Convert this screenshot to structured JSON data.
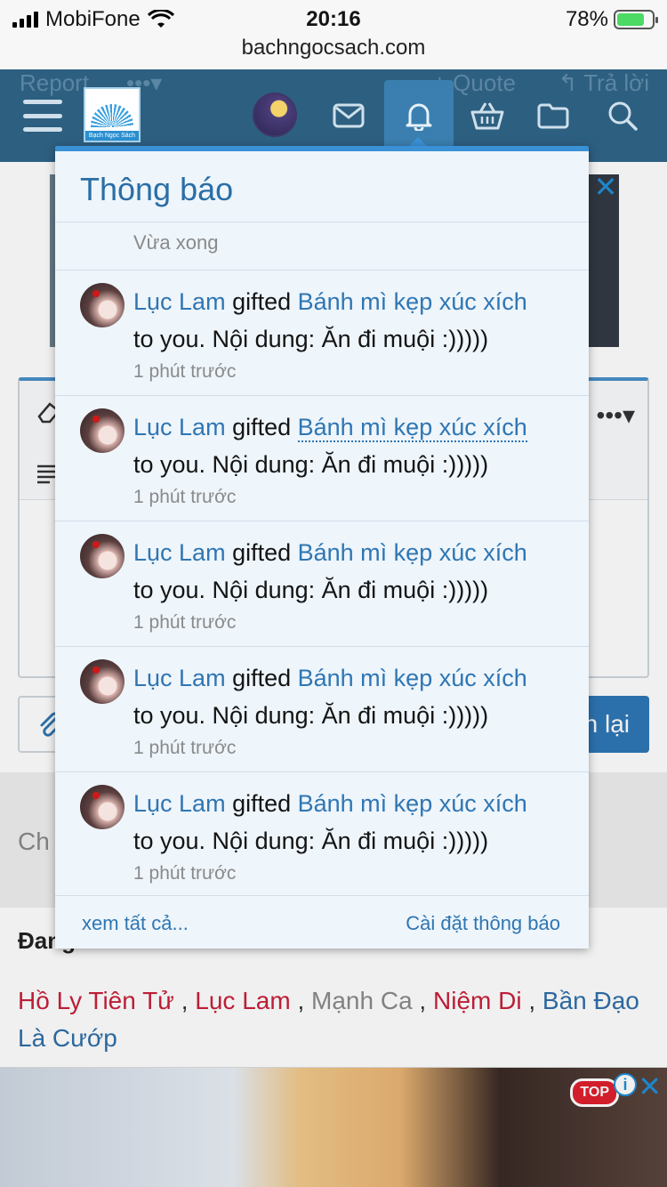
{
  "status_bar": {
    "carrier": "MobiFone",
    "time": "20:16",
    "battery": "78%",
    "battery_level": 0.78
  },
  "browser": {
    "url": "bachngocsach.com"
  },
  "header": {
    "faded_links": {
      "report": "Report",
      "more": "•••▾",
      "quote": "+ Quote",
      "reply": "↰ Trả lời"
    },
    "logo_text": "Bạch Ngọc Sách"
  },
  "notifications": {
    "title": "Thông báo",
    "just_now": "Vừa xong",
    "items": [
      {
        "user": "Lục Lam",
        "verb": " gifted ",
        "gift": "Bánh mì kẹp xúc xích",
        "message": "to you. Nội dung: Ăn đi muội :)))))",
        "time": "1 phút trước"
      },
      {
        "user": "Lục Lam",
        "verb": " gifted ",
        "gift": "Bánh mì kẹp xúc xích",
        "message": "to you. Nội dung: Ăn đi muội :)))))",
        "time": "1 phút trước"
      },
      {
        "user": "Lục Lam",
        "verb": " gifted ",
        "gift": "Bánh mì kẹp xúc xích",
        "message": "to you. Nội dung: Ăn đi muội :)))))",
        "time": "1 phút trước"
      },
      {
        "user": "Lục Lam",
        "verb": " gifted ",
        "gift": "Bánh mì kẹp xúc xích",
        "message": "to you. Nội dung: Ăn đi muội :)))))",
        "time": "1 phút trước"
      },
      {
        "user": "Lục Lam",
        "verb": " gifted ",
        "gift": "Bánh mì kẹp xúc xích",
        "message": "to you. Nội dung: Ăn đi muội :)))))",
        "time": "1 phút trước"
      }
    ],
    "see_all": "xem tất cả...",
    "settings": "Cài đặt thông báo"
  },
  "page": {
    "reply_button": "n lại",
    "grey_text": "Ch",
    "viewers_title": "Đang",
    "viewers": [
      {
        "name": "Hồ Ly Tiên Tử",
        "color": "#c8203a"
      },
      {
        "name": "Lục Lam",
        "color": "#c8203a"
      },
      {
        "name": "Mạnh Ca",
        "color": "#8a8a8a"
      },
      {
        "name": "Niệm Di",
        "color": "#c8203a"
      },
      {
        "name": "Bần Đạo Là Cướp",
        "color": "#2f6fa8"
      }
    ],
    "ad_badge": "TOP"
  },
  "icons": [
    "menu-icon",
    "mail-icon",
    "bell-icon",
    "basket-icon",
    "folder-icon",
    "search-icon",
    "close-icon",
    "info-icon",
    "paperclip-icon",
    "eraser-icon",
    "align-icon"
  ]
}
